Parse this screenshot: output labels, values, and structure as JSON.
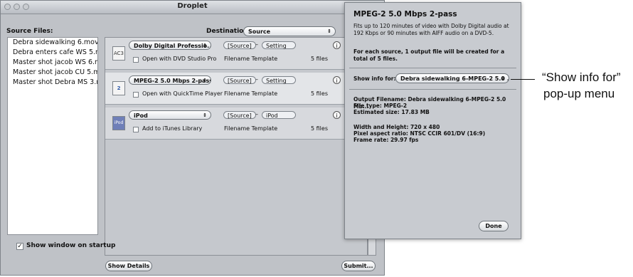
{
  "window": {
    "title": "Droplet"
  },
  "labels": {
    "source_files": "Source Files:",
    "destination": "Destination:",
    "destination_value": "Source"
  },
  "source_files": [
    "Debra sidewalking 6.mov",
    "Debra enters cafe WS 5.mov",
    "Master shot jacob WS 6.mov",
    "Master shot jacob CU 5.mov",
    "Master shot Debra MS 3.mov"
  ],
  "settings": [
    {
      "preset": "Dolby Digital Professio...",
      "open_with": "Open with DVD Studio Pro",
      "template": "Filename Template",
      "files": "5 files",
      "token1": "[Source]",
      "token2": "Setting",
      "icon": "AC3"
    },
    {
      "preset": "MPEG-2 5.0 Mbps 2-pass",
      "open_with": "Open with QuickTime Player",
      "template": "Filename Template",
      "files": "5 files",
      "token1": "[Source]",
      "token2": "Setting",
      "icon": "2"
    },
    {
      "preset": "iPod",
      "open_with": "Add to iTunes Library",
      "template": "Filename Template",
      "files": "5 files",
      "token1": "[Source]",
      "token2": "iPod",
      "icon": "iPod"
    }
  ],
  "show_on_startup": "Show window on startup",
  "buttons": {
    "show_details": "Show Details",
    "submit": "Submit...",
    "done": "Done"
  },
  "info_panel": {
    "title": "MPEG-2 5.0 Mbps 2-pass",
    "description": "Fits up to 120 minutes of video with Dolby Digital audio at 192 Kbps or 90 minutes with AIFF audio on a DVD-5.",
    "output_note": "For each source, 1 output file will be created for a total of 5 files.",
    "show_info_for_label": "Show info for:",
    "show_info_for_value": "Debra sidewalking 6-MPEG-2 5.0 ...",
    "output_filename": "Output Filename: Debra sidewalking 6-MPEG-2 5.0 Mb...",
    "file_type": "File type: MPEG-2",
    "estimated_size": "Estimated size: 17.83 MB",
    "width_height": "Width and Height: 720 x 480",
    "pixel_aspect": "Pixel aspect ratio: NTSC CCIR 601/DV (16:9)",
    "frame_rate": "Frame rate: 29.97 fps"
  },
  "callout": {
    "line1": "“Show info for”",
    "line2": "pop-up menu"
  }
}
